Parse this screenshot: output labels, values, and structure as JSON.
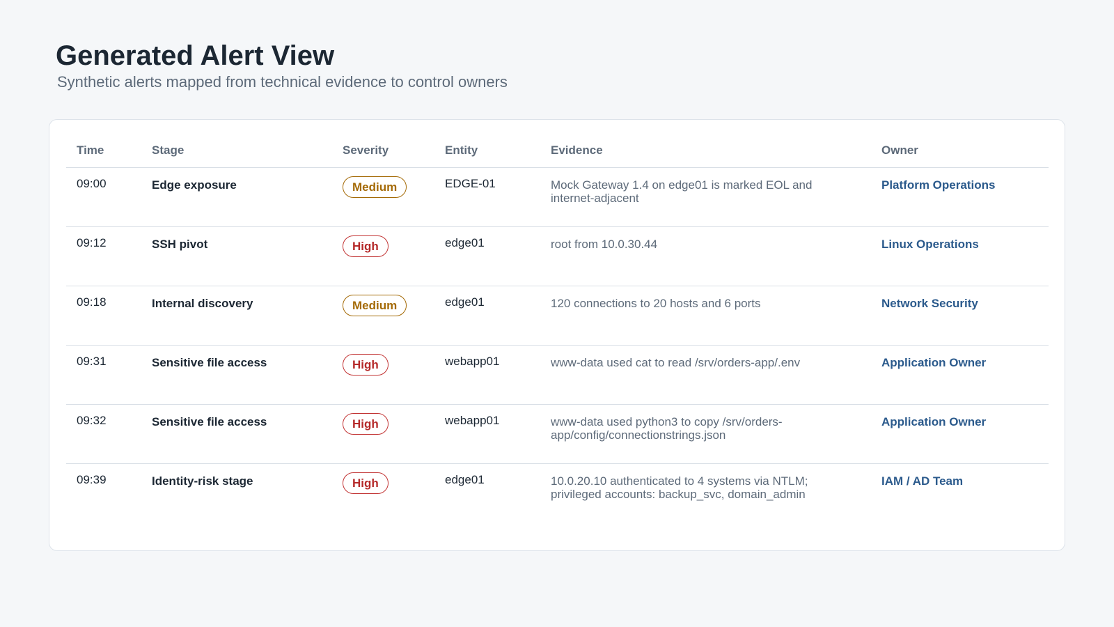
{
  "header": {
    "title": "Generated Alert View",
    "subtitle": "Synthetic alerts mapped from technical evidence to control owners"
  },
  "colors": {
    "background": "#f5f7f9",
    "card": "#ffffff",
    "title": "#1c2733",
    "muted": "#5d6a79",
    "owner_link": "#2b5a8c",
    "severity_medium": "#a46a06",
    "severity_high": "#b52a2a"
  },
  "table": {
    "columns": [
      "Time",
      "Stage",
      "Severity",
      "Entity",
      "Evidence",
      "Owner"
    ],
    "rows": [
      {
        "time": "09:00",
        "stage": "Edge exposure",
        "severity": "Medium",
        "entity": "EDGE-01",
        "evidence": "Mock Gateway 1.4 on edge01 is marked EOL and internet-adjacent",
        "owner": "Platform Operations"
      },
      {
        "time": "09:12",
        "stage": "SSH pivot",
        "severity": "High",
        "entity": "edge01",
        "evidence": "root from 10.0.30.44",
        "owner": "Linux Operations"
      },
      {
        "time": "09:18",
        "stage": "Internal discovery",
        "severity": "Medium",
        "entity": "edge01",
        "evidence": "120 connections to 20 hosts and 6 ports",
        "owner": "Network Security"
      },
      {
        "time": "09:31",
        "stage": "Sensitive file access",
        "severity": "High",
        "entity": "webapp01",
        "evidence": "www-data used cat to read /srv/orders-app/.env",
        "owner": "Application Owner"
      },
      {
        "time": "09:32",
        "stage": "Sensitive file access",
        "severity": "High",
        "entity": "webapp01",
        "evidence": "www-data used python3 to copy /srv/orders-app/config/connectionstrings.json",
        "owner": "Application Owner"
      },
      {
        "time": "09:39",
        "stage": "Identity-risk stage",
        "severity": "High",
        "entity": "edge01",
        "evidence": "10.0.20.10 authenticated to 4 systems via NTLM; privileged accounts: backup_svc, domain_admin",
        "owner": "IAM / AD Team"
      }
    ]
  }
}
